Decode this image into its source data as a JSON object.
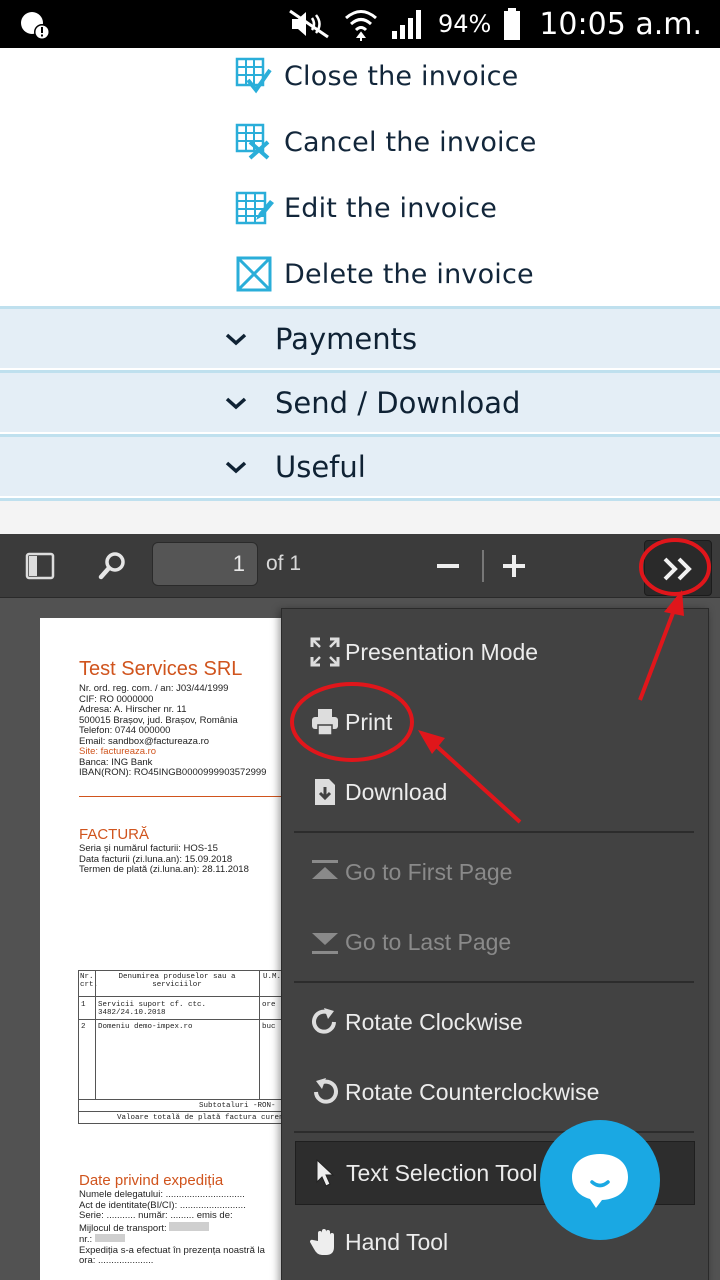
{
  "status_bar": {
    "battery_percent": "94%",
    "time": "10:05 a.m."
  },
  "invoice_actions": [
    {
      "label": "Close the invoice",
      "icon": "close-invoice-icon"
    },
    {
      "label": "Cancel the invoice",
      "icon": "cancel-invoice-icon"
    },
    {
      "label": "Edit the invoice",
      "icon": "edit-invoice-icon"
    },
    {
      "label": "Delete the invoice",
      "icon": "delete-invoice-icon"
    }
  ],
  "accordion": [
    {
      "label": "Payments"
    },
    {
      "label": "Send / Download"
    },
    {
      "label": "Useful"
    }
  ],
  "pdf_toolbar": {
    "page_number": "1",
    "page_of": "of 1"
  },
  "pdf_page": {
    "company": "Test Services SRL",
    "lines": [
      "Nr. ord. reg. com. / an: J03/44/1999",
      "CIF: RO 0000000",
      "Adresa: A. Hirscher nr. 11",
      "500015 Brașov, jud. Brașov, România",
      "Telefon: 0744 000000",
      "Email: sandbox@factureaza.ro",
      "Site: factureaza.ro",
      "Banca: ING Bank",
      "IBAN(RON): RO45INGB0000999903572999"
    ],
    "invoice_title": "FACTURĂ",
    "invoice_lines": [
      "Seria și numărul facturii:   HOS-15",
      "Data facturii (zi.luna.an):   15.09.2018",
      "Termen de plată (zi.luna.an): 28.11.2018"
    ],
    "table_header": [
      "Nr. crt.",
      "Denumirea produselor sau a serviciilor",
      "U.M."
    ],
    "table_rows": [
      [
        "1",
        "Servicii suport cf. ctc. 3482/24.10.2018",
        "ore"
      ],
      [
        "2",
        "Domeniu demo-impex.ro",
        "buc"
      ]
    ],
    "subtotal": "Subtotaluri -RON-",
    "total": "Valoare totală de plată factura curen",
    "shipping_title": "Date privind expediția",
    "shipping_lines": [
      "Numele delegatului: ..............................",
      "Act de identitate(BI/CI): .........................",
      "Serie: ........... număr: ......... emis de:",
      "Mijlocul de transport:",
      "nr.:",
      "Expediția s-a efectuat în prezența noastră la",
      "ora: ....................."
    ]
  },
  "pdf_menu": [
    {
      "label": "Presentation Mode",
      "icon": "presentation-mode-icon"
    },
    {
      "label": "Print",
      "icon": "print-icon"
    },
    {
      "label": "Download",
      "icon": "download-icon"
    },
    {
      "label": "Go to First Page",
      "icon": "first-page-icon"
    },
    {
      "label": "Go to Last Page",
      "icon": "last-page-icon"
    },
    {
      "label": "Rotate Clockwise",
      "icon": "rotate-clockwise-icon"
    },
    {
      "label": "Rotate Counterclockwise",
      "icon": "rotate-counterclockwise-icon"
    },
    {
      "label": "Text Selection Tool",
      "icon": "cursor-icon"
    },
    {
      "label": "Hand Tool",
      "icon": "hand-icon"
    }
  ],
  "colors": {
    "accent": "#1aa8e3",
    "annotation": "#e0161b",
    "brand_orange": "#d0541d"
  }
}
